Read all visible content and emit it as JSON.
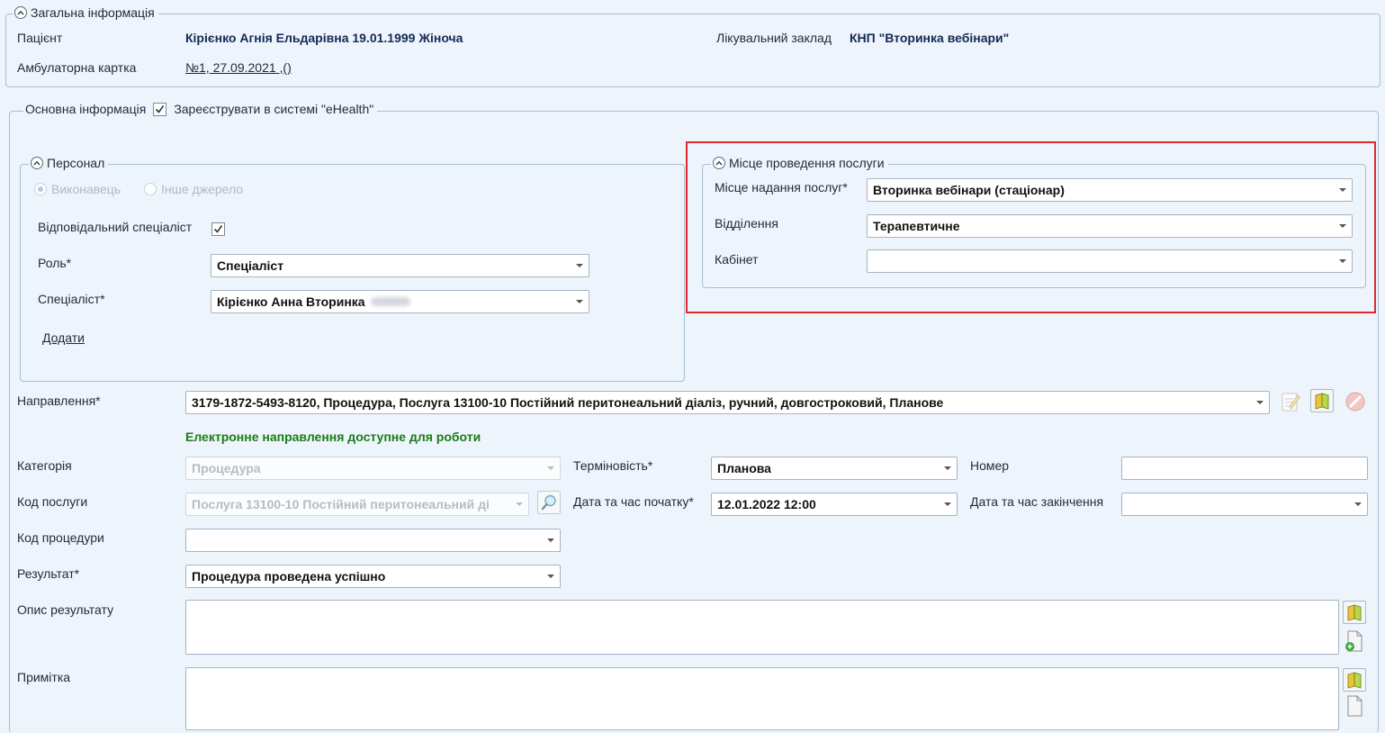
{
  "general": {
    "legend": "Загальна інформація",
    "patient_label": "Пацієнт",
    "patient_value": "Кірієнко Агнія Ельдарівна 19.01.1999 Жіноча",
    "facility_label": "Лікувальний заклад",
    "facility_value": "КНП \"Вторинка вебінари\"",
    "card_label": "Амбулаторна картка",
    "card_value": "№1, 27.09.2021 ,()"
  },
  "main": {
    "legend": "Основна інформація",
    "ehealth_label": "Зареєструвати в системі \"eHealth\"",
    "ehealth_checked": true
  },
  "personnel": {
    "legend": "Персонал",
    "radio_executor": "Виконавець",
    "radio_other": "Інше джерело",
    "responsible_label": "Відповідальний спеціаліст",
    "role_label": "Роль*",
    "role_value": "Спеціаліст",
    "specialist_label": "Спеціаліст*",
    "specialist_value": "Кірієнко Анна Вторинка",
    "add_link": "Додати"
  },
  "location": {
    "legend": "Місце проведення послуги",
    "place_label": "Місце надання послуг*",
    "place_value": "Вторинка вебінари (стаціонар)",
    "department_label": "Відділення",
    "department_value": "Терапевтичне",
    "cabinet_label": "Кабінет",
    "cabinet_value": ""
  },
  "referral": {
    "label": "Направлення*",
    "value": "3179-1872-5493-8120, Процедура, Послуга 13100-10 Постійний перитонеальний діаліз, ручний, довгостроковий, Планове",
    "status": "Електронне направлення доступне для роботи"
  },
  "details": {
    "category_label": "Категорія",
    "category_value": "Процедура",
    "urgency_label": "Терміновість*",
    "urgency_value": "Планова",
    "number_label": "Номер",
    "service_code_label": "Код послуги",
    "service_code_value": "Послуга 13100-10 Постійний перитонеальний ді",
    "start_label": "Дата та час початку*",
    "start_value": "12.01.2022 12:00",
    "end_label": "Дата та час закінчення",
    "procedure_code_label": "Код процедури",
    "result_label": "Результат*",
    "result_value": "Процедура проведена успішно",
    "result_desc_label": "Опис результату",
    "note_label": "Примітка"
  },
  "colors": {
    "highlight": "#e0282e",
    "status_green": "#1a7d1a",
    "value_blue": "#132a55"
  }
}
